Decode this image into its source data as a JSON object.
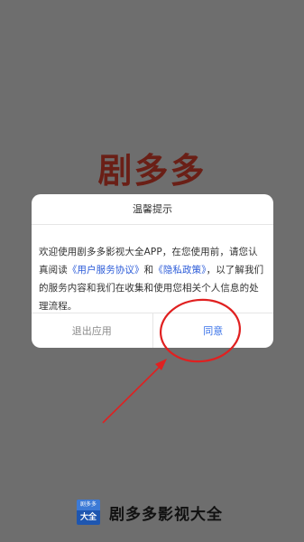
{
  "splash": {
    "logo_text": "剧多多"
  },
  "dialog": {
    "title": "温馨提示",
    "body_part1": "欢迎使用剧多多影视大全APP，在您使用前，请您认真阅读",
    "link_terms": "《用户服务协议》",
    "body_and": "和",
    "link_privacy": "《隐私政策》",
    "body_part2": "，以了解我们的服务内容和我们在收集和使用您相关个人信息的处理流程。",
    "exit_label": "退出应用",
    "agree_label": "同意"
  },
  "brand": {
    "icon_top_text": "剧多多",
    "icon_bottom_text": "大全",
    "name": "剧多多影视大全"
  },
  "colors": {
    "overlay": "#6e6e6e",
    "logo": "#6a1f16",
    "link": "#2b5bd8",
    "agree": "#3a73e8",
    "annotation": "#e02020"
  }
}
